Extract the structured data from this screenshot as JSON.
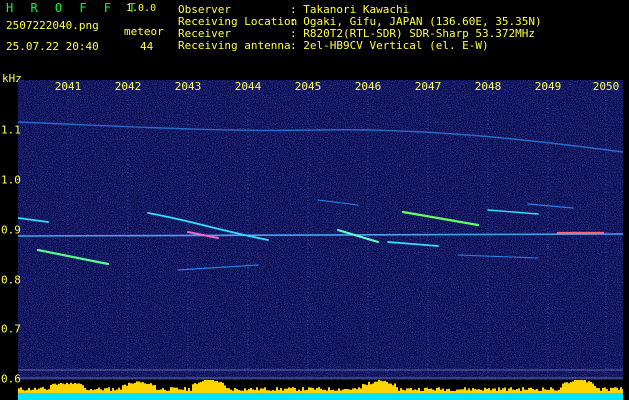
{
  "app": {
    "title": "H R O F F T",
    "version": "1.0.0"
  },
  "file": {
    "name": "2507222040.png",
    "datetime": "25.07.22 20:40"
  },
  "meteor": {
    "label": "meteor",
    "count": "44"
  },
  "info": [
    {
      "key": "Observer",
      "value": ": Takanori Kawachi"
    },
    {
      "key": "Receiving Location",
      "value": ": Ogaki, Gifu, JAPAN (136.60E, 35.35N)"
    },
    {
      "key": "Receiver",
      "value": ": R820T2(RTL-SDR) SDR-Sharp 53.372MHz"
    },
    {
      "key": "Receiving antenna",
      "value": ": 2el-HB9CV Vertical (el. E-W)"
    }
  ],
  "y_axis": {
    "unit": "kHz",
    "ticks": [
      "1.1",
      "1.0",
      "0.9",
      "0.8",
      "0.7",
      "0.6"
    ]
  },
  "x_axis": {
    "ticks": [
      "2041",
      "2042",
      "2043",
      "2044",
      "2045",
      "2046",
      "2047",
      "2048",
      "2049",
      "2050"
    ]
  },
  "colors": {
    "header_text": "#ffff44",
    "title": "#00ff33",
    "background": "#07074a",
    "bars": "#ffd400",
    "base": "#00e5ff"
  }
}
